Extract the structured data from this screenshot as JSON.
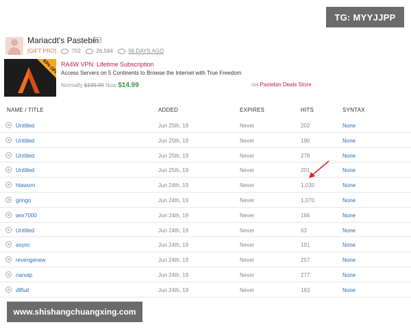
{
  "overlay": {
    "tg_badge": "TG: MYYJJPP",
    "watermark": "www.shishangchuangxing.com"
  },
  "profile": {
    "name": "Mariacdt's Pastebin",
    "badge": "[GIFT PRO]",
    "pastes_count": "702",
    "views_count": "26,584",
    "joined": "56 DAYS AGO"
  },
  "ad": {
    "title": "RA4W VPN: Lifetime Subscription",
    "description": "Access Servers on 5 Continents to Browse the Internet with True Freedom",
    "normally_label": "Normally",
    "old_price": "$199.99",
    "now_label": "Now",
    "new_price": "$14.99",
    "via_label": "via",
    "store": "Pastebin Deals Store",
    "image_ribbon": "93% OFF"
  },
  "table": {
    "headers": [
      "NAME / TITLE",
      "ADDED",
      "EXPIRES",
      "HITS",
      "SYNTAX"
    ],
    "rows": [
      {
        "title": "Untitled",
        "added": "Jun 25th, 19",
        "expires": "Never",
        "hits": "202",
        "syntax": "None"
      },
      {
        "title": "Untitled",
        "added": "Jun 25th, 19",
        "expires": "Never",
        "hits": "190",
        "syntax": "None"
      },
      {
        "title": "Untitled",
        "added": "Jun 25th, 19",
        "expires": "Never",
        "hits": "278",
        "syntax": "None"
      },
      {
        "title": "Untitled",
        "added": "Jun 25th, 19",
        "expires": "Never",
        "hits": "201",
        "syntax": "None"
      },
      {
        "title": "htaworn",
        "added": "Jun 24th, 19",
        "expires": "Never",
        "hits": "1,030",
        "syntax": "None"
      },
      {
        "title": "gringo",
        "added": "Jun 24th, 19",
        "expires": "Never",
        "hits": "1,070",
        "syntax": "None"
      },
      {
        "title": "wor7000",
        "added": "Jun 24th, 19",
        "expires": "Never",
        "hits": "166",
        "syntax": "None"
      },
      {
        "title": "Untitled",
        "added": "Jun 24th, 19",
        "expires": "Never",
        "hits": "63",
        "syntax": "None"
      },
      {
        "title": "async",
        "added": "Jun 24th, 19",
        "expires": "Never",
        "hits": "191",
        "syntax": "None"
      },
      {
        "title": "revengenew",
        "added": "Jun 24th, 19",
        "expires": "Never",
        "hits": "257",
        "syntax": "None"
      },
      {
        "title": "nanoip",
        "added": "Jun 24th, 19",
        "expires": "Never",
        "hits": "277",
        "syntax": "None"
      },
      {
        "title": "dllfud",
        "added": "Jun 24th, 19",
        "expires": "Never",
        "hits": "163",
        "syntax": "None"
      }
    ]
  },
  "colors": {
    "link": "#2d6fb7",
    "ad_title": "#c2185b",
    "price_new": "#3a9a3a",
    "annotation_arrow": "#e0231b"
  },
  "icons": {
    "paste_row": "globe-icon",
    "message": "mail-icon",
    "annotation": "red-arrow-icon"
  }
}
